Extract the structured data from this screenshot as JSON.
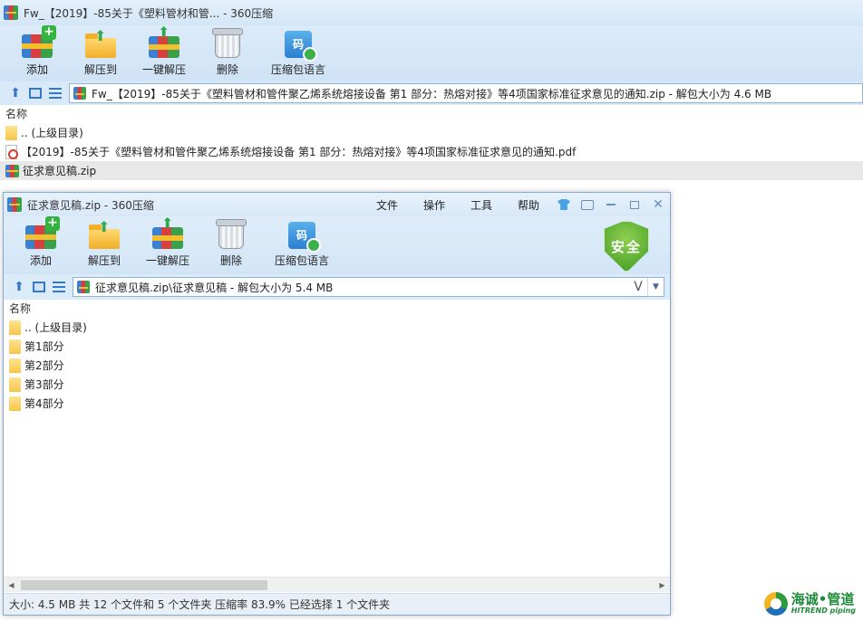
{
  "back_window": {
    "title": "Fw_【2019】-85关于《塑料管材和管... - 360压缩",
    "toolbar": {
      "add_label": "添加",
      "extract_to_label": "解压到",
      "one_click_extract_label": "一键解压",
      "delete_label": "删除",
      "language_label": "压缩包语言",
      "language_icon_glyph": "码"
    },
    "address": "Fw_【2019】-85关于《塑料管材和管件聚乙烯系统熔接设备 第1 部分：热熔对接》等4项国家标准征求意见的通知.zip - 解包大小为 4.6 MB",
    "column_name": "名称",
    "rows": [
      {
        "label": ".. (上级目录)",
        "type": "folder"
      },
      {
        "label": "【2019】-85关于《塑料管材和管件聚乙烯系统熔接设备 第1 部分：热熔对接》等4项国家标准征求意见的通知.pdf",
        "type": "pdf"
      },
      {
        "label": "征求意见稿.zip",
        "type": "zip",
        "selected": true
      }
    ]
  },
  "front_window": {
    "title": "征求意见稿.zip - 360压缩",
    "menus": [
      "文件",
      "操作",
      "工具",
      "帮助"
    ],
    "toolbar": {
      "add_label": "添加",
      "extract_to_label": "解压到",
      "one_click_extract_label": "一键解压",
      "delete_label": "删除",
      "language_label": "压缩包语言",
      "language_icon_glyph": "码"
    },
    "security_badge": "安全",
    "address": "征求意见稿.zip\\征求意见稿 - 解包大小为 5.4 MB",
    "address_dropdown_glyph": "V",
    "column_name": "名称",
    "rows": [
      {
        "label": ".. (上级目录)",
        "type": "folder"
      },
      {
        "label": "第1部分",
        "type": "folder"
      },
      {
        "label": "第2部分",
        "type": "folder"
      },
      {
        "label": "第3部分",
        "type": "folder"
      },
      {
        "label": "第4部分",
        "type": "folder"
      }
    ],
    "status": "大小: 4.5 MB 共 12 个文件和 5 个文件夹 压缩率 83.9% 已经选择 1 个文件夹"
  },
  "watermark": {
    "cn": "海诚•管道",
    "en": "HITREND piping"
  },
  "colors": {
    "title_bg": "#d8e8f8",
    "toolbar_bg": "#d2e5f7",
    "accent_blue": "#3479c9",
    "shield_green": "#3f9a22",
    "folder_yellow": "#f6c64a"
  }
}
